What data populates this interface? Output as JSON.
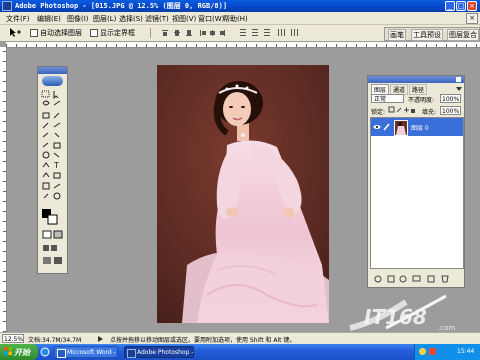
{
  "app": {
    "title": "Adobe Photoshop - [015.JPG @ 12.5% (图层 0, RGB/8)]",
    "window_controls": [
      "_",
      "□",
      "×"
    ]
  },
  "menu": [
    "文件(F)",
    "编辑(E)",
    "图像(I)",
    "图层(L)",
    "选择(S)",
    "滤镜(T)",
    "视图(V)",
    "窗口(W)",
    "帮助(H)"
  ],
  "options": {
    "auto_select_layer": "自动选择图层",
    "show_bounding_box": "显示定界框",
    "palette_tabs": [
      "画笔",
      "工具预设",
      "图层复合"
    ]
  },
  "layers": {
    "tabs": [
      "图层",
      "通道",
      "路径"
    ],
    "blend_mode": "正常",
    "opacity_label": "不透明度:",
    "opacity": "100%",
    "lock_label": "锁定:",
    "fill_label": "填充:",
    "fill": "100%",
    "rows": [
      {
        "name": "图层 0"
      }
    ]
  },
  "status": {
    "zoom": "12.5%",
    "doc": "文档:34.7M/34.7M",
    "hint": "点按并拖移以移动图层或选区。要用附加选项，使用 Shift 和 Alt 键。"
  },
  "taskbar": {
    "start": "开始",
    "tasks": [
      "Microsoft Word -",
      "Adobe Photoshop -"
    ],
    "clock": "15:44"
  },
  "watermark": "IT168.com",
  "colors": {
    "titlebar": "#0447c7",
    "workspace": "#9c9c9c",
    "canvas_bg": "#5a2a22",
    "dress": "#f3d0dc",
    "selected_layer": "#3a6ed8"
  }
}
